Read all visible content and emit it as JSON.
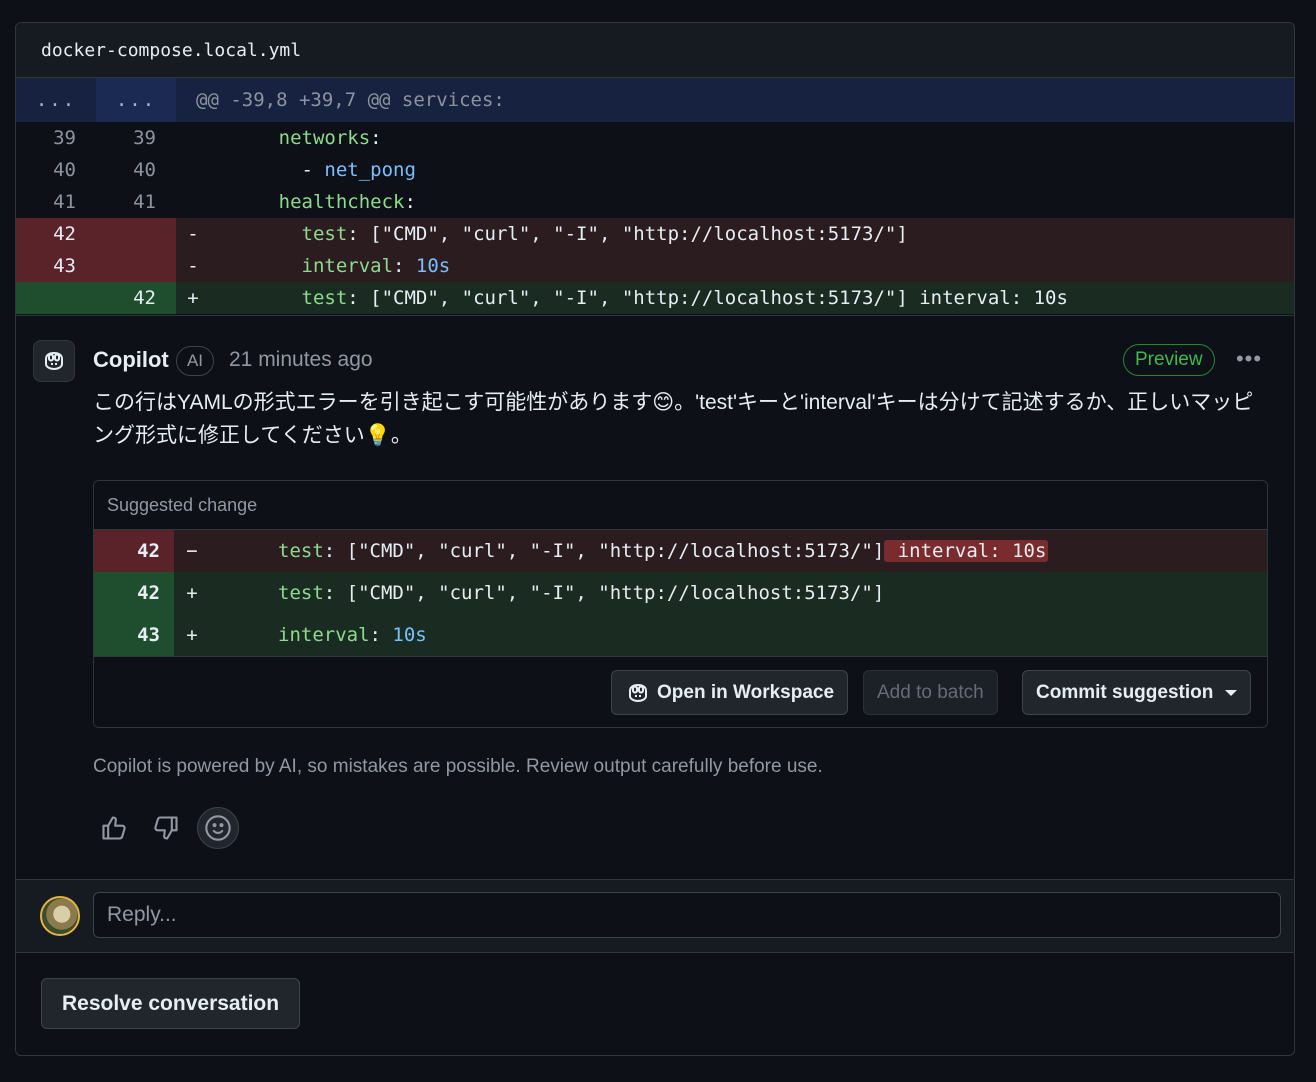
{
  "file": {
    "name": "docker-compose.local.yml"
  },
  "hunk": {
    "left": "...",
    "right": "...",
    "header": "@@ -39,8 +39,7 @@ services:"
  },
  "diff_lines": [
    {
      "old": "39",
      "new": "39",
      "sign": "",
      "indent": "      ",
      "key": "networks",
      "rest": ":"
    },
    {
      "old": "40",
      "new": "40",
      "sign": "",
      "indent": "        - ",
      "val": "net_pong"
    },
    {
      "old": "41",
      "new": "41",
      "sign": "",
      "indent": "      ",
      "key": "healthcheck",
      "rest": ":"
    },
    {
      "old": "42",
      "new": "",
      "sign": "-",
      "indent": "        ",
      "key": "test",
      "rest": ": [\"CMD\", \"curl\", \"-I\", \"http://localhost:5173/\"]"
    },
    {
      "old": "43",
      "new": "",
      "sign": "-",
      "indent": "        ",
      "key": "interval",
      "rest": ": ",
      "num": "10s"
    },
    {
      "old": "",
      "new": "42",
      "sign": "+",
      "indent": "        ",
      "key": "test",
      "rest": ": [\"CMD\", \"curl\", \"-I\", \"http://localhost:5173/\"] interval: 10s"
    }
  ],
  "comment": {
    "author": "Copilot",
    "badge": "AI",
    "time": "21 minutes ago",
    "preview": "Preview",
    "kebab": "•••",
    "body": "この行はYAMLの形式エラーを引き起こす可能性があります😊。'test'キーと'interval'キーは分けて記述するか、正しいマッピング形式に修正してください💡。"
  },
  "suggestion": {
    "title": "Suggested change",
    "lines": [
      {
        "ln": "42",
        "sign": "−",
        "key": "test",
        "rest": ": [\"CMD\", \"curl\", \"-I\", \"http://localhost:5173/\"]",
        "highlight": " interval: 10s"
      },
      {
        "ln": "42",
        "sign": "+",
        "key": "test",
        "rest": ": [\"CMD\", \"curl\", \"-I\", \"http://localhost:5173/\"]"
      },
      {
        "ln": "43",
        "sign": "+",
        "key": "interval",
        "rest": ": ",
        "num": "10s"
      }
    ],
    "buttons": {
      "workspace": "Open in Workspace",
      "batch": "Add to batch",
      "commit": "Commit suggestion"
    }
  },
  "disclaimer": "Copilot is powered by AI, so mistakes are possible. Review output carefully before use.",
  "reply": {
    "placeholder": "Reply..."
  },
  "resolve": {
    "label": "Resolve conversation"
  }
}
